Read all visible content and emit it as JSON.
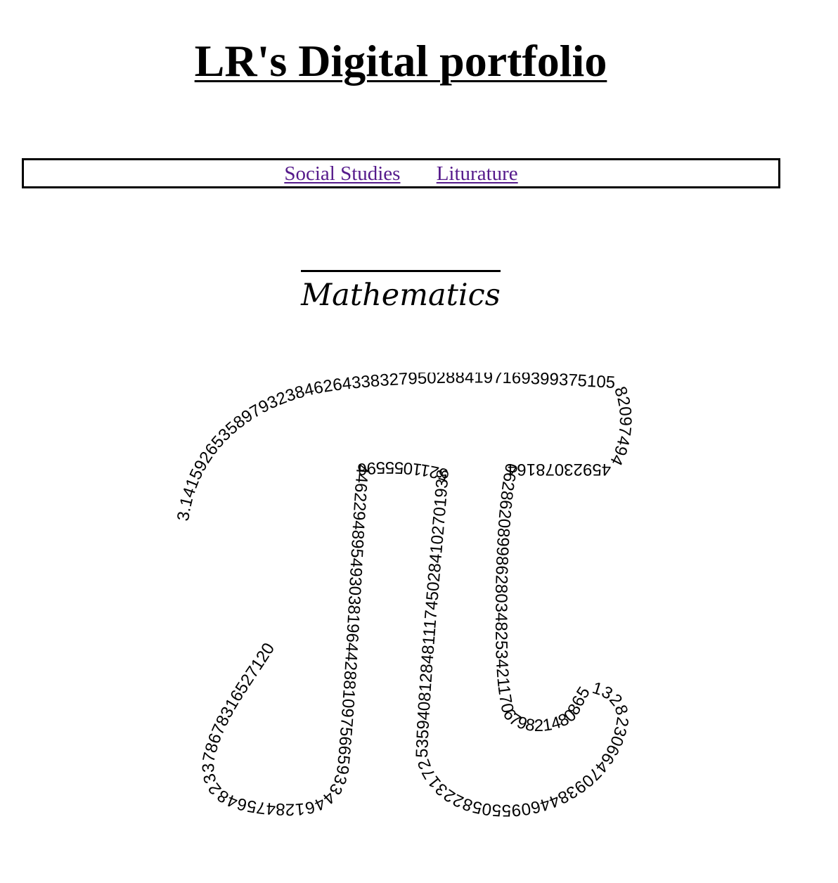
{
  "page": {
    "title": "LR's Digital portfolio"
  },
  "nav": {
    "links": [
      {
        "label": "Social Studies"
      },
      {
        "label": "Liturature"
      }
    ],
    "link_color": "#551a8b"
  },
  "section": {
    "heading": "Mathematics"
  },
  "pi_art": {
    "digits": "3.14159265358979323846264338327950288419716939937510582097494459230781640628620899862803482534211706798214808651328230664709384460955058223172535940812848111745028410270193852110555964462294895493038196442881097566593344612847564823378678316527120"
  }
}
